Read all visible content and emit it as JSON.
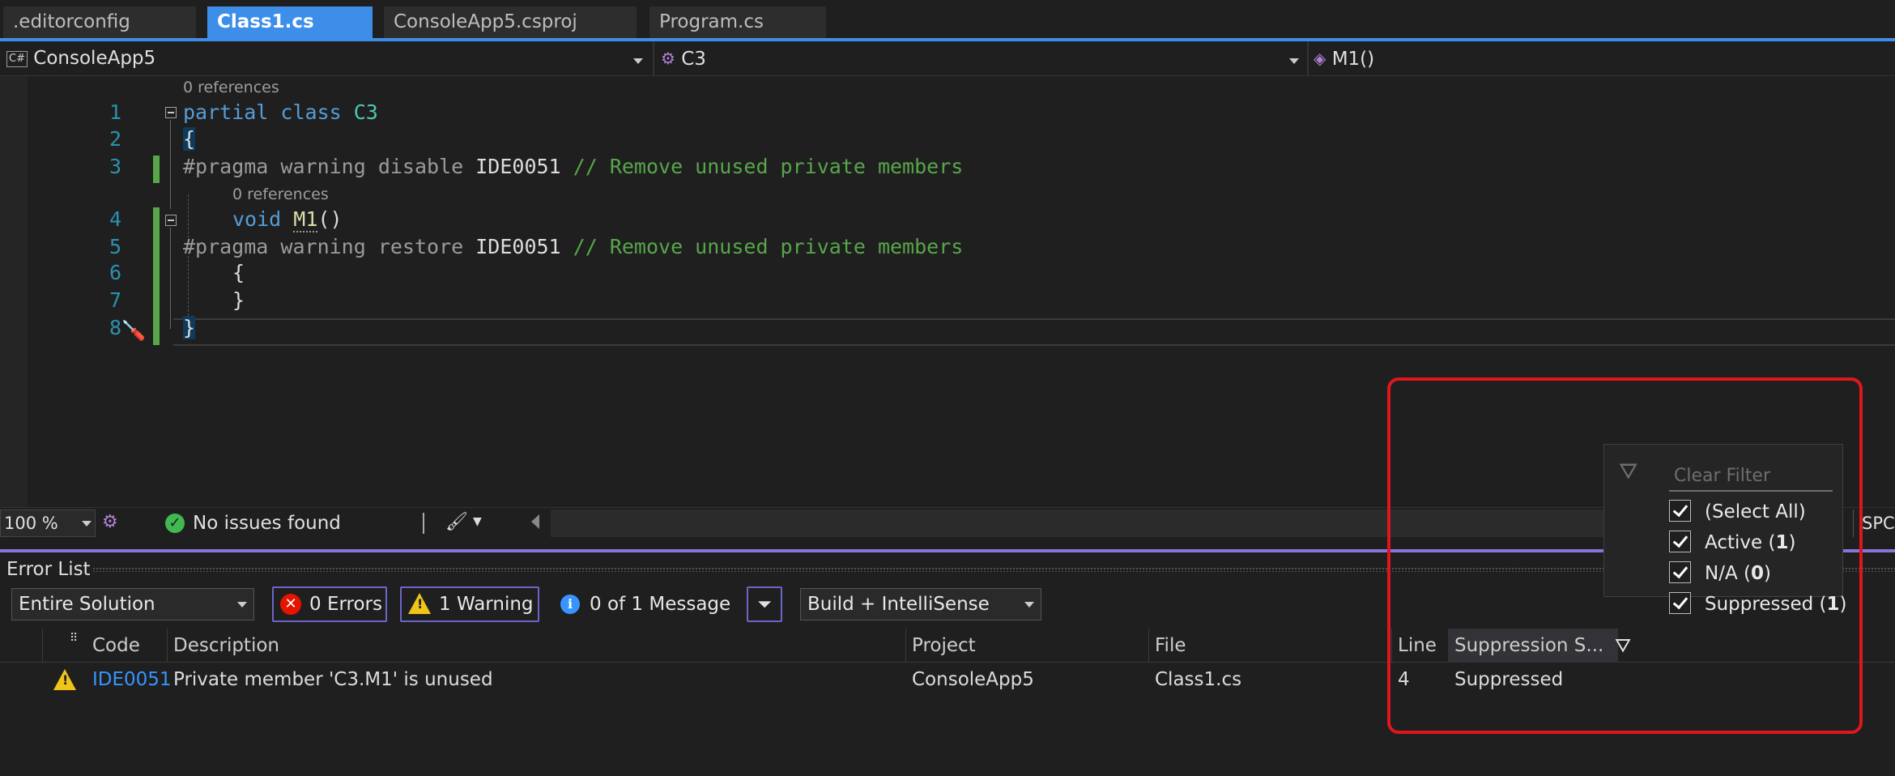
{
  "tabs": [
    {
      "label": ".editorconfig"
    },
    {
      "label": "Class1.cs"
    },
    {
      "label": "ConsoleApp5.csproj"
    },
    {
      "label": "Program.cs"
    }
  ],
  "navbar": {
    "project": "ConsoleApp5",
    "type": "C3",
    "member": "M1()",
    "project_icon": "C#"
  },
  "code": {
    "lens_refs": "0 references",
    "line_numbers": [
      "1",
      "2",
      "3",
      "4",
      "5",
      "6",
      "7",
      "8"
    ],
    "l1_kw": "partial class",
    "l1_name": "C3",
    "l2": "{",
    "l3_pre": "#pragma warning disable",
    "l3_id": "IDE0051",
    "l3_comment": "// Remove unused private members",
    "l4_kw": "void",
    "l4_fn": "M1",
    "l4_parens": "()",
    "l5_pre": "#pragma warning restore",
    "l5_id": "IDE0051",
    "l5_comment": "// Remove unused private members",
    "l6": "{",
    "l7": "}",
    "l8": "}"
  },
  "status": {
    "zoom": "100 %",
    "issues": "No issues found",
    "right_text": "SPC"
  },
  "error_list": {
    "title": "Error List",
    "scope": "Entire Solution",
    "errors": "0 Errors",
    "warnings": "1 Warning",
    "messages": "0 of 1 Message",
    "build_filter": "Build + IntelliSense",
    "columns": {
      "code": "Code",
      "description": "Description",
      "project": "Project",
      "file": "File",
      "line": "Line",
      "suppression": "Suppression S..."
    },
    "rows": [
      {
        "code": "IDE0051",
        "description": "Private member 'C3.M1' is unused",
        "project": "ConsoleApp5",
        "file": "Class1.cs",
        "line": "4",
        "suppression": "Suppressed"
      }
    ]
  },
  "filter_popup": {
    "placeholder": "Clear Filter",
    "options": [
      {
        "label": "(Select All)",
        "count": "",
        "checked": true
      },
      {
        "label": "Active",
        "count": "1",
        "checked": true
      },
      {
        "label": "N/A",
        "count": "0",
        "checked": true
      },
      {
        "label": "Suppressed",
        "count": "1",
        "checked": true
      }
    ]
  },
  "colors": {
    "tab_active": "#3d8ee8",
    "error_list_accent": "#8a73d9",
    "highlight_box": "#e0161e",
    "keyword": "#569cd6",
    "type_name": "#4ec9b0",
    "comment": "#57a64a"
  }
}
